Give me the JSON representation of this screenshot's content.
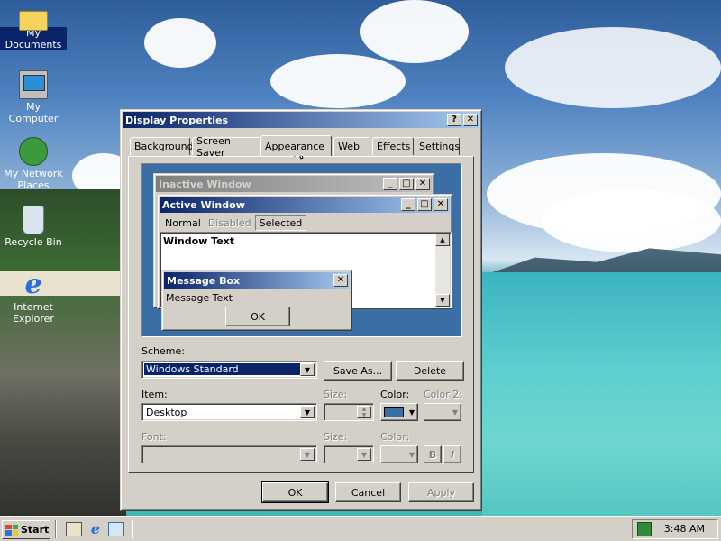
{
  "desktop": {
    "icons": [
      {
        "label": "My Documents",
        "icon": "folder-icon"
      },
      {
        "label": "My Computer",
        "icon": "computer-icon"
      },
      {
        "label_line1": "My Network",
        "label_line2": "Places",
        "icon": "network-places-icon"
      },
      {
        "label": "Recycle Bin",
        "icon": "recycle-bin-icon"
      },
      {
        "label_line1": "Internet",
        "label_line2": "Explorer",
        "icon": "internet-explorer-icon"
      }
    ]
  },
  "dialog": {
    "title": "Display Properties",
    "help_button": "?",
    "close_button": "✕",
    "tabs": [
      "Background",
      "Screen Saver",
      "Appearance",
      "Web",
      "Effects",
      "Settings"
    ],
    "selected_tab": "Appearance",
    "preview": {
      "inactive_title": "Inactive Window",
      "active_title": "Active Window",
      "menu": [
        "Normal",
        "Disabled",
        "Selected"
      ],
      "window_text": "Window Text",
      "msgbox_title": "Message Box",
      "msgbox_text": "Message Text",
      "msgbox_ok": "OK"
    },
    "scheme_label": "Scheme:",
    "scheme_value": "Windows Standard",
    "save_as": "Save As...",
    "delete": "Delete",
    "item_label": "Item:",
    "item_value": "Desktop",
    "size_label": "Size:",
    "color_label": "Color:",
    "color2_label": "Color 2:",
    "font_label": "Font:",
    "font_size_label": "Size:",
    "font_color_label": "Color:",
    "bold_button": "B",
    "italic_button": "I",
    "ok": "OK",
    "cancel": "Cancel",
    "apply": "Apply",
    "desktop_color": "#3a6ea5"
  },
  "taskbar": {
    "start": "Start",
    "quick_launch": [
      "show-desktop-icon",
      "internet-explorer-icon",
      "outlook-express-icon"
    ],
    "clock": "3:48 AM"
  }
}
